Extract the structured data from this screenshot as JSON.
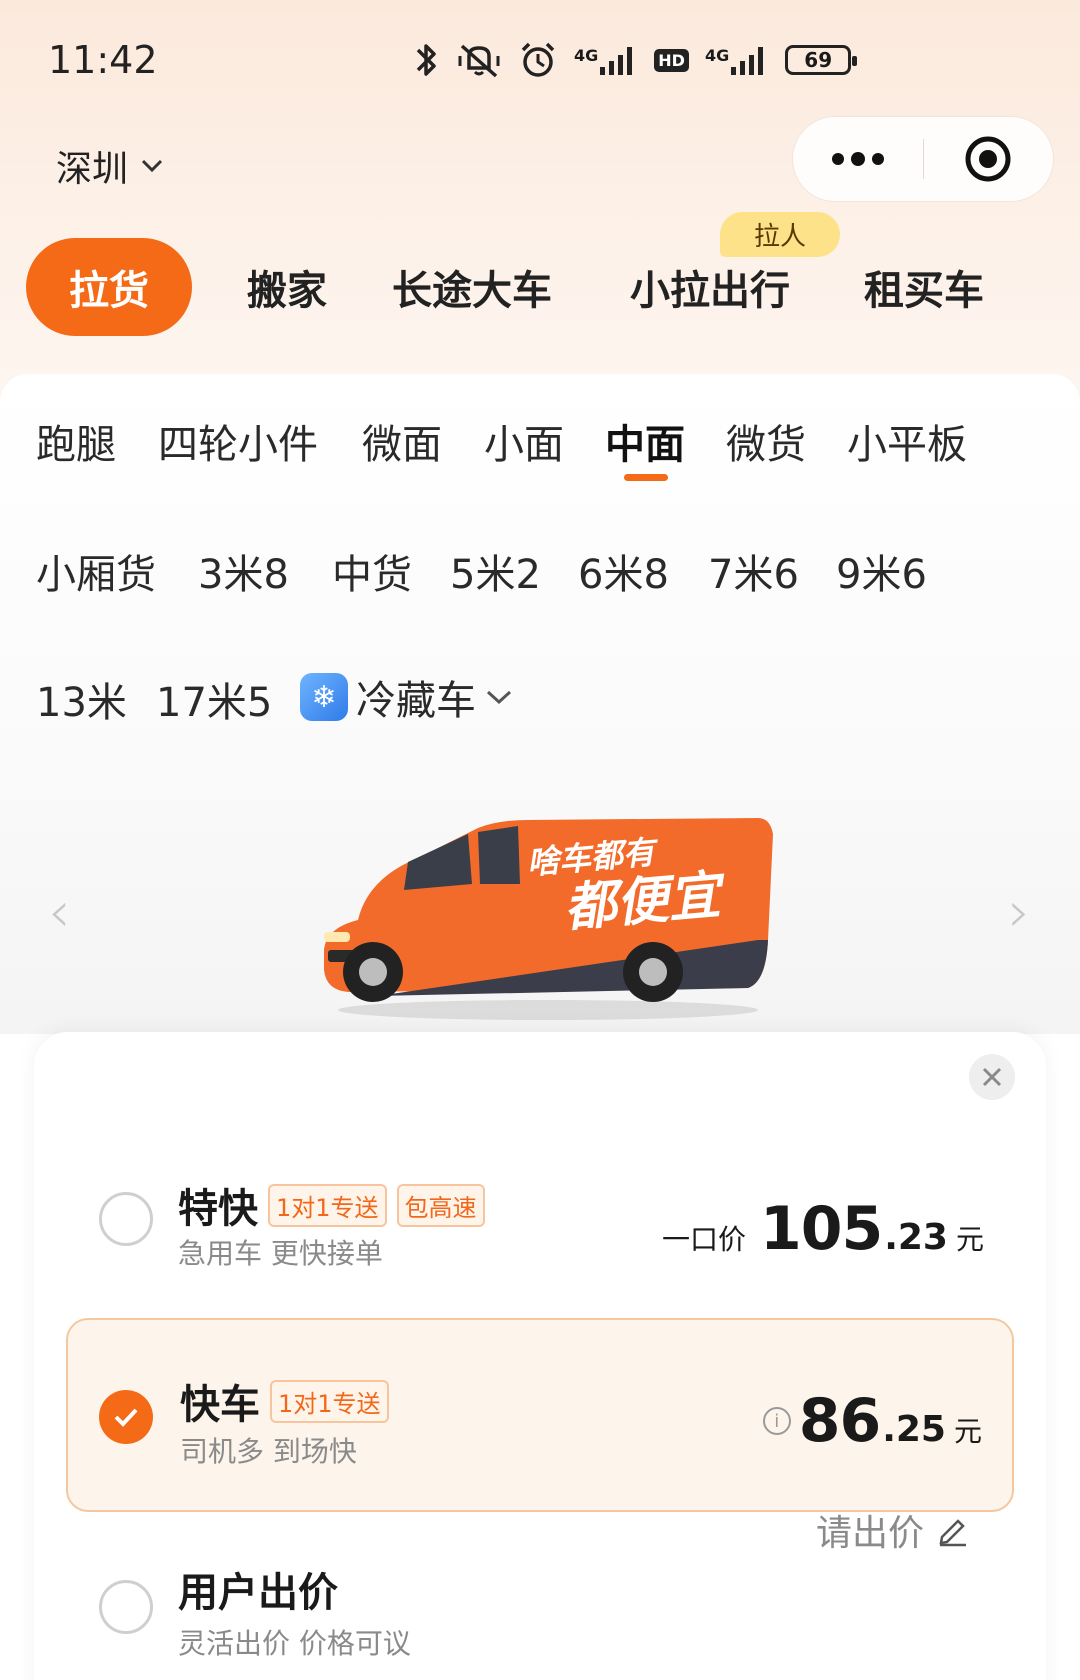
{
  "status_bar": {
    "time": "11:42",
    "network_1": "4G",
    "network_2": "4G",
    "hd": "HD",
    "battery": "69",
    "icons": [
      "bluetooth-icon",
      "mute-vibrate-icon",
      "alarm-icon",
      "signal-icon",
      "signal-icon"
    ]
  },
  "header": {
    "city": "深圳",
    "capsule_icons": [
      "more-dots-icon",
      "target-close-icon"
    ]
  },
  "top_tabs": {
    "items": [
      {
        "label": "拉货",
        "active": true
      },
      {
        "label": "搬家",
        "active": false
      },
      {
        "label": "长途大车",
        "active": false
      },
      {
        "label": "小拉出行",
        "active": false
      },
      {
        "label": "租买车",
        "active": false
      }
    ],
    "badge": "拉人"
  },
  "vehicle_types": {
    "row1": [
      "跑腿",
      "四轮小件",
      "微面",
      "小面",
      "中面",
      "微货",
      "小平板"
    ],
    "row2": [
      "小厢货",
      "3米8",
      "中货",
      "5米2",
      "6米8",
      "7米6",
      "9米6"
    ],
    "row3": [
      "13米",
      "17米5",
      "冷藏车"
    ],
    "selected": "中面"
  },
  "van": {
    "slogan_line1": "啥车都有",
    "slogan_line2": "都便宜"
  },
  "options": [
    {
      "title": "特快",
      "tags": [
        "1对1专送",
        "包高速"
      ],
      "subtitle": "急用车 更快接单",
      "price_prefix": "一口价",
      "price_int": "105",
      "price_dec": ".23",
      "price_unit": "元",
      "selected": false
    },
    {
      "title": "快车",
      "tags": [
        "1对1专送"
      ],
      "subtitle": "司机多 到场快",
      "price_int": "86",
      "price_dec": ".25",
      "price_unit": "元",
      "selected": true
    },
    {
      "title": "用户出价",
      "subtitle": "灵活出价 价格可议",
      "action": "请出价",
      "selected": false
    }
  ],
  "colors": {
    "accent": "#f46a17",
    "tag_text": "#f2681a",
    "selected_bg": "#fdf5ec",
    "badge_bg": "#fde28a"
  }
}
